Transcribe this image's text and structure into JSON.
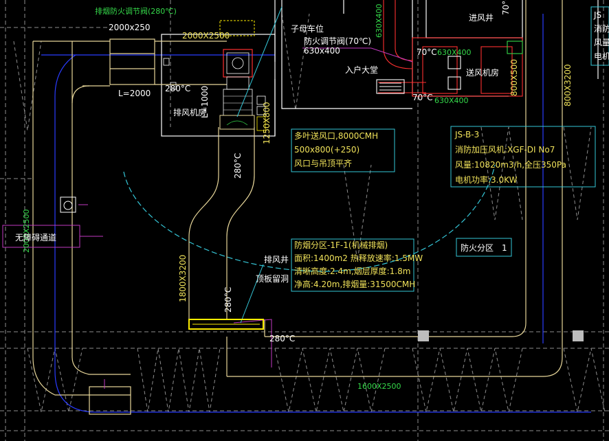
{
  "colors": {
    "background": "#000000",
    "duct": "#e8d79a",
    "wall": "#ffffff",
    "grid": "#9b9b9b",
    "cyan_line": "#35c7d8",
    "blue_line": "#2a2aff",
    "green_text": "#35d94a",
    "red_line": "#ff3030",
    "magenta_line": "#c23ac2",
    "yellow_highlight": "#ffee00"
  },
  "annotations": {
    "damper_top_label": "排烟防火调节阀(280℃)",
    "damper_top_size": "2000x250",
    "duct_top_size": "2000X2500",
    "duct_left_size": "2000X2500",
    "duct_right_size": "800X3200",
    "duct_bottom_size": "1600X2500",
    "duct_vertical_size": "1800X3200",
    "length_label_1": "L=2000",
    "length_label_2": "L=1000",
    "temp_280_a": "280°C",
    "temp_280_b": "280°C",
    "temp_280_c": "280°C",
    "temp_280_d": "280°C",
    "temp_70_a": "70°C",
    "temp_70_b": "70°C",
    "temp_70_c": "70°C",
    "exhaust_room": "排风机房",
    "supply_room": "送风机房",
    "supply_shaft": "进风井",
    "entrance_hall": "入户大堂",
    "parent_child_car": "子母车位",
    "fire_damper_70": "防火调节阀(70℃)",
    "fire_damper_size": "630x400",
    "duct_630_a": "630X400",
    "duct_630_b": "630X400",
    "duct_630_c": "630X400",
    "duct_800_v": "800X500",
    "duct_1250": "1250X800",
    "exhaust_shaft": "排风井",
    "roof_opening": "顶板留洞",
    "accessible_path": "无障碍通道",
    "fire_zone_label": "防火分区",
    "fire_zone_no": "1"
  },
  "box_air_outlet": {
    "line1": "多叶送风口,8000CMH",
    "line2": "500x800(+250)",
    "line3": "风口与吊顶平齐"
  },
  "box_fan": {
    "line1": "JS-B-3",
    "line2": "消防加压风机:XGF-DI No7",
    "line3": "风量:10820m3/h,全压350Pa",
    "line4": "电机功率:3.0KW"
  },
  "box_smoke_zone": {
    "line1": "防烟分区-1F-1(机械排烟)",
    "line2": "面积:1400m2 热释放速率:1.5MW",
    "line3": "清晰高度:2.4m,烟层厚度:1.8m",
    "line4": "净高:4.20m,排烟量:31500CMH"
  },
  "right_edge": {
    "line1": "JS",
    "line2": "消防",
    "line3": "风量",
    "line4": "电机"
  }
}
